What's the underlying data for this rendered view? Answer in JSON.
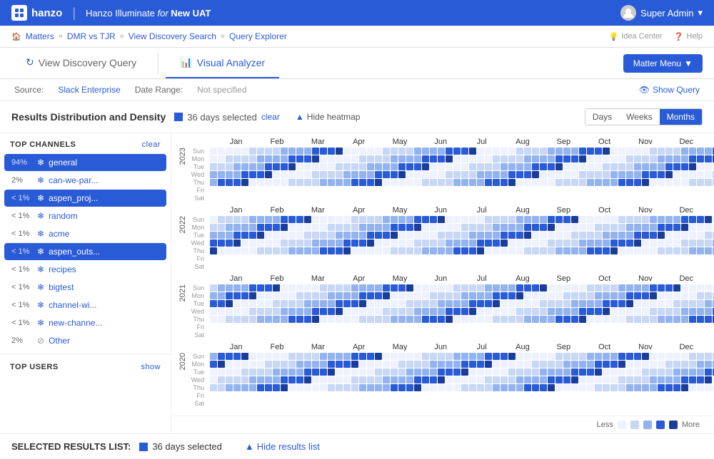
{
  "topnav": {
    "logo_text": "hanzo",
    "divider": "|",
    "app_name": "Hanzo Illuminate",
    "app_for": "for",
    "app_env": "New UAT",
    "user_label": "Super Admin"
  },
  "breadcrumb": {
    "items": [
      "Matters",
      "DMR vs TJR",
      "View Discovery Search",
      "Query Explorer"
    ],
    "idea_center": "Idea Center",
    "help": "Help"
  },
  "tabs": {
    "view_discovery": "View Discovery Query",
    "visual_analyzer": "Visual Analyzer",
    "matter_menu": "Matter Menu"
  },
  "source_bar": {
    "source_label": "Source:",
    "source_value": "Slack Enterprise",
    "range_label": "Date Range:",
    "range_value": "Not specified",
    "show_query": "Show Query"
  },
  "distribution": {
    "title": "Results Distribution and Density",
    "days_selected": "36 days selected",
    "clear": "clear",
    "hide_heatmap": "Hide heatmap",
    "days_btn": "Days",
    "weeks_btn": "Weeks",
    "months_btn": "Months"
  },
  "sidebar": {
    "channels_header": "TOP CHANNELS",
    "clear": "clear",
    "channels": [
      {
        "pct": "94%",
        "name": "general",
        "active": true
      },
      {
        "pct": "2%",
        "name": "can-we-par...",
        "active": false
      },
      {
        "pct": "< 1%",
        "name": "aspen_proj...",
        "active": true
      },
      {
        "pct": "< 1%",
        "name": "random",
        "active": false
      },
      {
        "pct": "< 1%",
        "name": "acme",
        "active": false
      },
      {
        "pct": "< 1%",
        "name": "aspen_outs...",
        "active": true
      },
      {
        "pct": "< 1%",
        "name": "recipes",
        "active": false
      },
      {
        "pct": "< 1%",
        "name": "bigtest",
        "active": false
      },
      {
        "pct": "< 1%",
        "name": "channel-wi...",
        "active": false
      },
      {
        "pct": "< 1%",
        "name": "new-channe...",
        "active": false
      },
      {
        "pct": "2%",
        "name": "Other",
        "other": true
      }
    ],
    "users_header": "TOP USERS",
    "show": "show"
  },
  "months": [
    "Jan",
    "Feb",
    "Mar",
    "Apr",
    "May",
    "Jun",
    "Jul",
    "Aug",
    "Sep",
    "Oct",
    "Nov",
    "Dec"
  ],
  "days": [
    "Sun",
    "Mon",
    "Tue",
    "Wed",
    "Thu",
    "Fri",
    "Sat"
  ],
  "years": [
    "2023",
    "2022",
    "2021"
  ],
  "legend": {
    "less": "Less",
    "more": "More",
    "levels": [
      "#eef2ff",
      "#c7d7f5",
      "#92b3f0",
      "#2a5bd7",
      "#1a3d99"
    ]
  },
  "bottom": {
    "label": "SELECTED RESULTS LIST:",
    "days_selected": "36 days selected",
    "hide_results": "Hide results list"
  }
}
